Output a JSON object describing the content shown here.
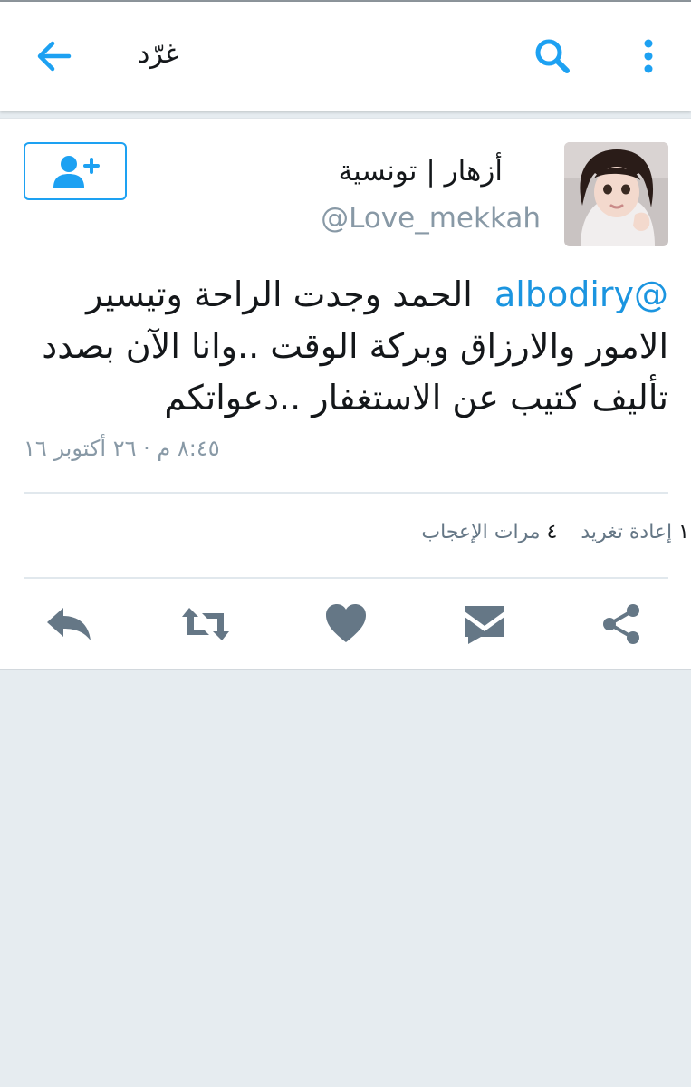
{
  "appbar": {
    "title": "غرّد",
    "back_icon": "arrow-left-icon",
    "search_icon": "search-icon",
    "more_icon": "more-vertical-icon"
  },
  "tweet": {
    "author_name": "أزهار | تونسية",
    "author_handle": "@Love_mekkah",
    "follow_icon": "follow-user-icon",
    "mention": "@albodiry",
    "text": "الحمد وجدت الراحة وتيسير الامور والارزاق وبركة الوقت ..وانا الآن بصدد تأليف كتيب عن الاستغفار ..دعواتكم",
    "timestamp": "٨:٤٥ م · ٢٦ أكتوبر ١٦"
  },
  "stats": {
    "retweets_count": "١",
    "retweets_label": "إعادة تغريد",
    "likes_count": "٤",
    "likes_label": "مرات الإعجاب"
  },
  "actions": [
    "reply-icon",
    "retweet-icon",
    "like-icon",
    "direct-message-icon",
    "share-icon"
  ],
  "colors": {
    "accent": "#1da1f2",
    "icon_gray": "#657786",
    "muted_text": "#8899a6",
    "background": "#e6ecf0"
  }
}
